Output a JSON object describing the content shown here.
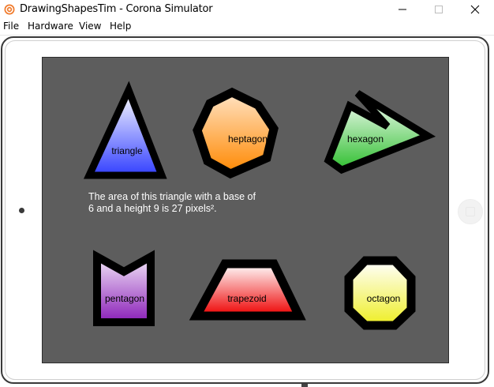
{
  "window": {
    "title": "DrawingShapesTim - Corona Simulator",
    "minimize_icon": "minimize-icon",
    "maximize_icon": "maximize-icon",
    "close_icon": "close-icon",
    "app_icon": "corona-logo-icon"
  },
  "menu": {
    "items": [
      "File",
      "Hardware",
      "View",
      "Help"
    ]
  },
  "screen": {
    "background": "#5d5d5d",
    "info_text_line1": "The area of this triangle with a base of",
    "info_text_line2": "6 and a height 9 is 27 pixels².",
    "shapes": [
      {
        "label": "triangle",
        "gradient_top": "#ffffff",
        "gradient_bottom": "#3340ff"
      },
      {
        "label": "heptagon",
        "gradient_top": "#ffe3c4",
        "gradient_bottom": "#ff8800"
      },
      {
        "label": "hexagon",
        "gradient_top": "#ffffff",
        "gradient_bottom": "#2fbf2f"
      },
      {
        "label": "pentagon",
        "gradient_top": "#f2e6f8",
        "gradient_bottom": "#8a1eb8"
      },
      {
        "label": "trapezoid",
        "gradient_top": "#ffffff",
        "gradient_bottom": "#ee0000"
      },
      {
        "label": "octagon",
        "gradient_top": "#ffffff",
        "gradient_bottom": "#eeee22"
      }
    ]
  }
}
